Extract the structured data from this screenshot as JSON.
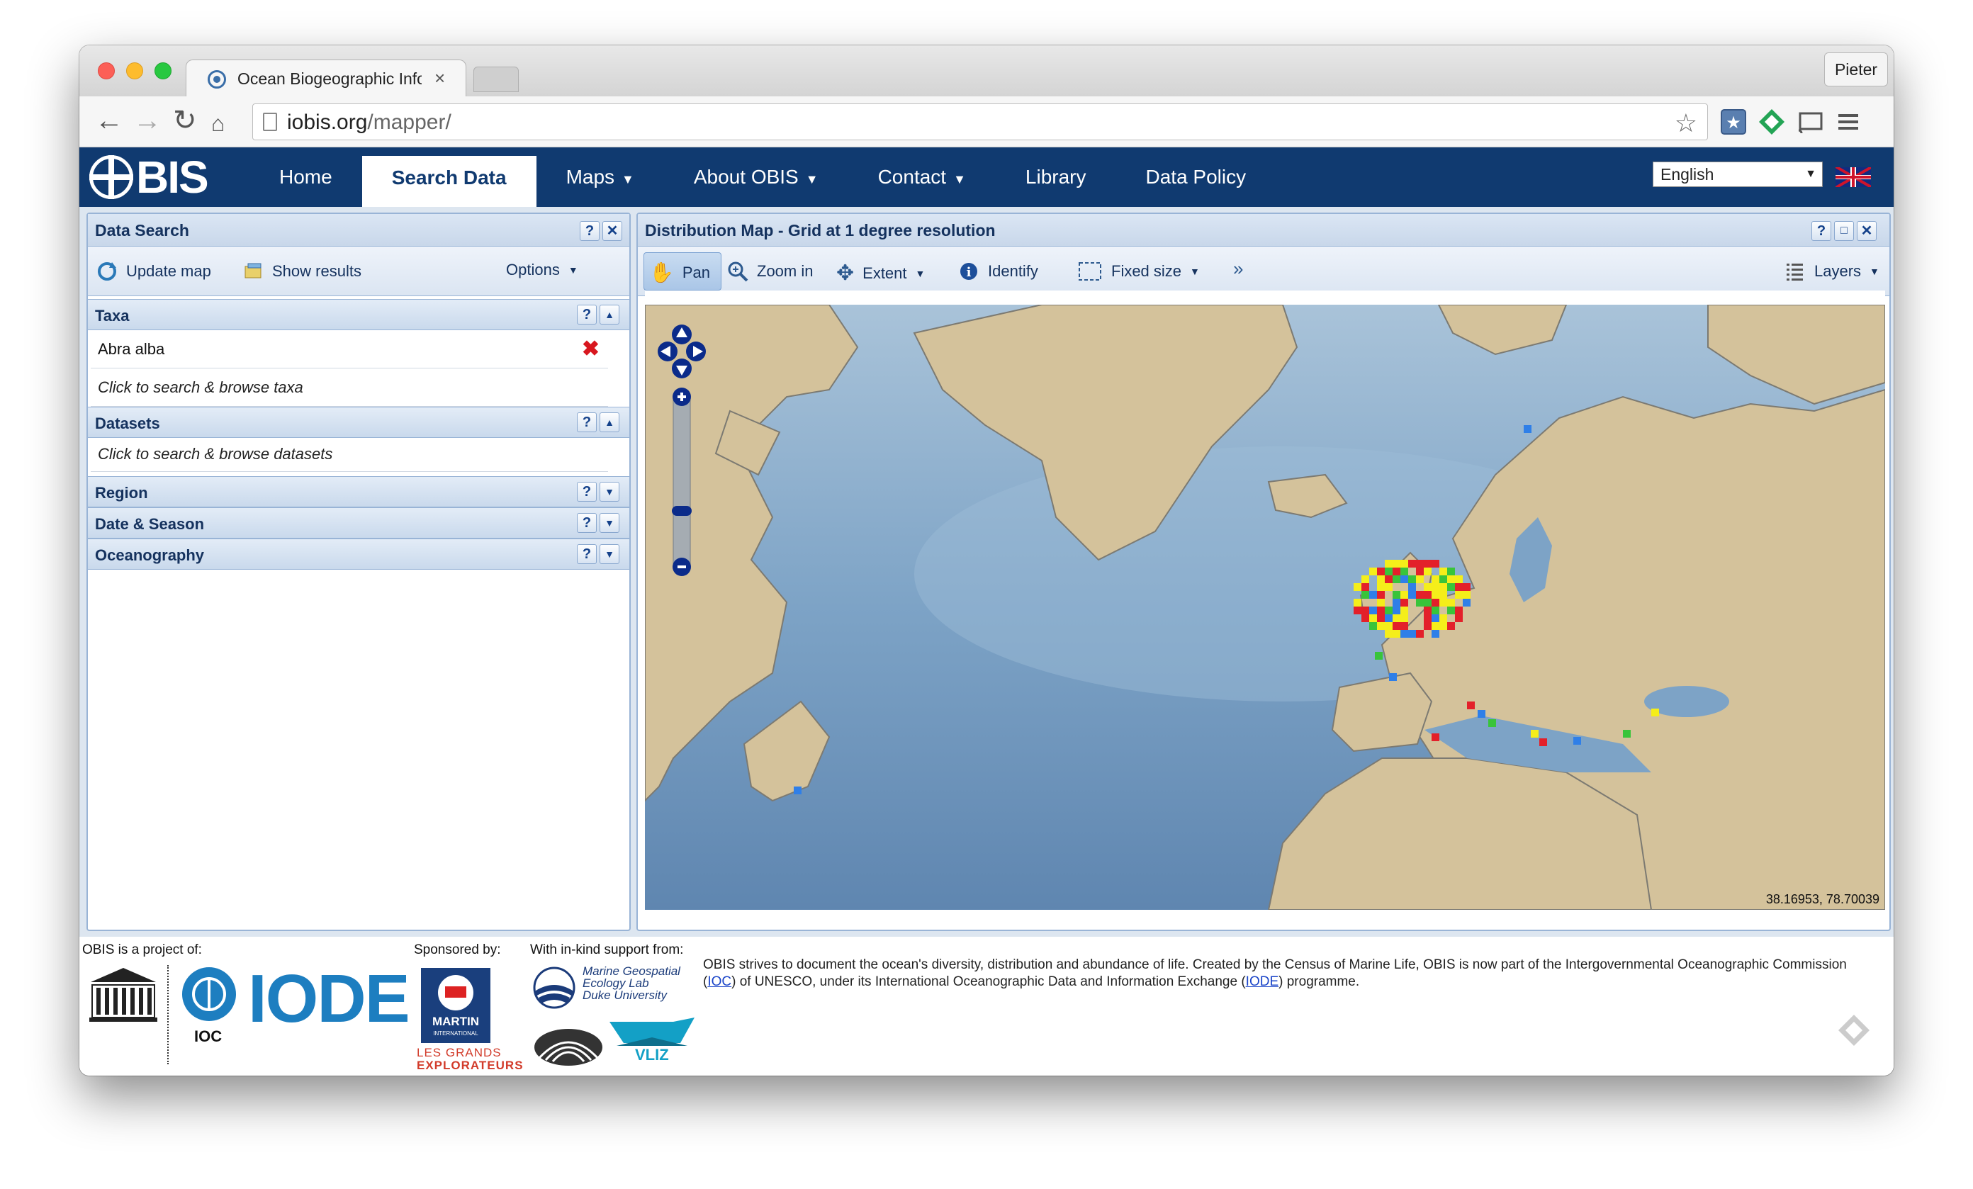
{
  "browser": {
    "tab_title": "Ocean Biogeographic Infor",
    "tab_close": "×",
    "profile": "Pieter",
    "url_host": "iobis.org",
    "url_path": "/mapper/"
  },
  "site": {
    "logo_text": "BIS",
    "menu": [
      {
        "label": "Home"
      },
      {
        "label": "Search Data"
      },
      {
        "label": "Maps"
      },
      {
        "label": "About OBIS"
      },
      {
        "label": "Contact"
      },
      {
        "label": "Library"
      },
      {
        "label": "Data Policy"
      }
    ],
    "language": "English"
  },
  "search_panel": {
    "title": "Data Search",
    "help": "?",
    "close": "✕",
    "update_map": "Update map",
    "show_results": "Show results",
    "options": "Options",
    "sections": {
      "taxa": "Taxa",
      "datasets": "Datasets",
      "region": "Region",
      "date_season": "Date & Season",
      "oceanography": "Oceanography"
    },
    "taxa_selected": "Abra alba",
    "taxa_prompt": "Click to search & browse taxa",
    "datasets_prompt": "Click to search & browse datasets"
  },
  "map_panel": {
    "title": "Distribution Map - Grid at 1 degree resolution",
    "pan": "Pan",
    "zoom_in": "Zoom in",
    "extent": "Extent",
    "identify": "Identify",
    "fixed_size": "Fixed size",
    "more": "»",
    "layers": "Layers",
    "coordinates": "38.16953, 78.70039"
  },
  "footer": {
    "project_of": "OBIS is a project of:",
    "sponsored_by": "Sponsored by:",
    "inkind": "With in-kind support from:",
    "ioc": "IOC",
    "iode": "IODE",
    "martin": "MARTIN",
    "martin_sub": "INTERNATIONAL",
    "grands": "LES GRANDS",
    "explorateurs": "EXPLORATEURS",
    "unesco": "UNESCO",
    "mgel_line1": "Marine Geospatial",
    "mgel_line2": "Ecology Lab",
    "mgel_line3": "Duke University",
    "vliz": "VLIZ",
    "desc_part1": "OBIS strives to document the ocean's diversity, distribution and abundance of life. Created by the Census of Marine Life, OBIS is now part of the Intergovernmental Oceanographic Commission (",
    "desc_ioc": "IOC",
    "desc_part2": ") of UNESCO, under its International Oceanographic Data and Information Exchange (",
    "desc_iode": "IODE",
    "desc_part3": ") programme."
  },
  "colors": {
    "header_bg": "#103a70",
    "panel_border": "#99b4d6",
    "ocean": "#8db0cf",
    "land": "#d4c29b",
    "occ_red": "#e3202a",
    "occ_yellow": "#f5ee1a",
    "occ_green": "#39c43a",
    "occ_blue": "#2f7fe8"
  }
}
